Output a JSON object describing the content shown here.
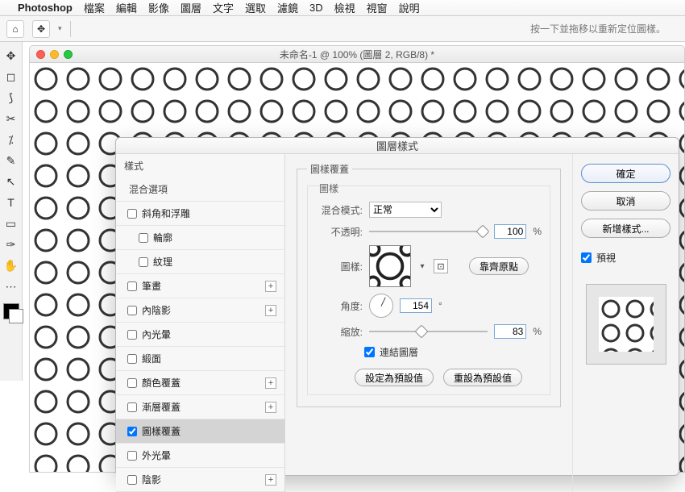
{
  "menubar": {
    "app_name": "Photoshop",
    "items": [
      "檔案",
      "編輯",
      "影像",
      "圖層",
      "文字",
      "選取",
      "濾鏡",
      "3D",
      "檢視",
      "視窗",
      "說明"
    ]
  },
  "options_bar": {
    "hint": "按一下並拖移以重新定位圖樣。"
  },
  "document": {
    "title": "未命名-1 @ 100% (圖層 2, RGB/8) *"
  },
  "dialog": {
    "title": "圖層樣式",
    "styles_header": "樣式",
    "blend_options": "混合選項",
    "rows": [
      {
        "label": "斜角和浮雕",
        "checked": false,
        "indent": false,
        "plus": false
      },
      {
        "label": "輪廓",
        "checked": false,
        "indent": true,
        "plus": false
      },
      {
        "label": "紋理",
        "checked": false,
        "indent": true,
        "plus": false
      },
      {
        "label": "筆畫",
        "checked": false,
        "indent": false,
        "plus": true
      },
      {
        "label": "內陰影",
        "checked": false,
        "indent": false,
        "plus": true
      },
      {
        "label": "內光暈",
        "checked": false,
        "indent": false,
        "plus": false
      },
      {
        "label": "緞面",
        "checked": false,
        "indent": false,
        "plus": false
      },
      {
        "label": "顏色覆蓋",
        "checked": false,
        "indent": false,
        "plus": true
      },
      {
        "label": "漸層覆蓋",
        "checked": false,
        "indent": false,
        "plus": true
      },
      {
        "label": "圖樣覆蓋",
        "checked": true,
        "indent": false,
        "plus": false,
        "selected": true
      },
      {
        "label": "外光暈",
        "checked": false,
        "indent": false,
        "plus": false
      },
      {
        "label": "陰影",
        "checked": false,
        "indent": false,
        "plus": true
      }
    ],
    "center": {
      "group_title": "圖樣覆蓋",
      "inner_title": "圖樣",
      "blend_mode_label": "混合模式:",
      "blend_mode_value": "正常",
      "opacity_label": "不透明:",
      "opacity_value": "100",
      "pattern_label": "圖樣:",
      "snap_button": "靠齊原點",
      "angle_label": "角度:",
      "angle_value": "154",
      "angle_unit": "°",
      "scale_label": "縮放:",
      "scale_value": "83",
      "link_label": "連結圖層",
      "link_checked": true,
      "make_default": "設定為預設值",
      "reset_default": "重設為預設值"
    },
    "right": {
      "ok": "確定",
      "cancel": "取消",
      "new_style": "新增樣式...",
      "preview_label": "預視",
      "preview_checked": true
    }
  }
}
